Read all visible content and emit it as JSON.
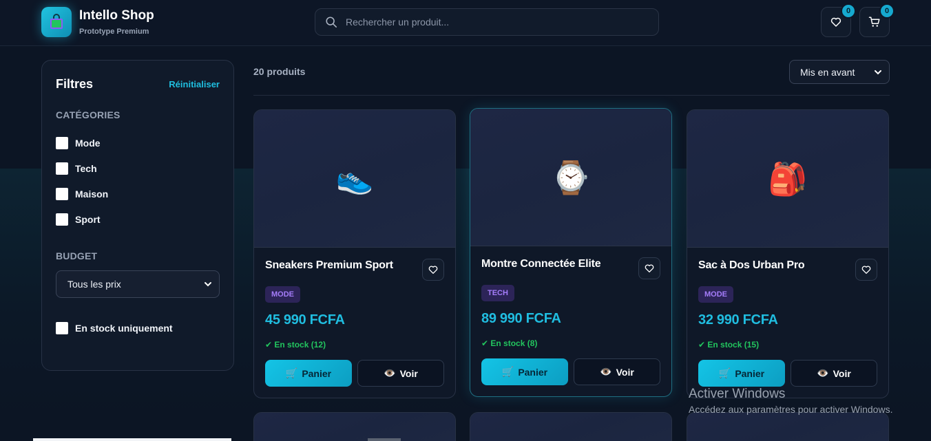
{
  "brand": {
    "title": "Intello Shop",
    "subtitle": "Prototype Premium",
    "logo_icon": "shopping-bag-icon"
  },
  "search": {
    "placeholder": "Rechercher un produit...",
    "value": ""
  },
  "header": {
    "wishlist": {
      "icon": "heart-icon",
      "count": "0"
    },
    "cart": {
      "icon": "cart-icon",
      "count": "0"
    }
  },
  "sidebar": {
    "title": "Filtres",
    "reset_label": "Réinitialiser",
    "categories_title": "CATÉGORIES",
    "categories": [
      {
        "label": "Mode",
        "checked": false
      },
      {
        "label": "Tech",
        "checked": false
      },
      {
        "label": "Maison",
        "checked": false
      },
      {
        "label": "Sport",
        "checked": false
      }
    ],
    "budget_title": "BUDGET",
    "budget_selected": "Tous les prix",
    "in_stock_label": "En stock uniquement",
    "in_stock_checked": false
  },
  "toolbar": {
    "count_label": "20 produits",
    "sort_selected": "Mis en avant"
  },
  "products": [
    {
      "name": "Sneakers Premium Sport",
      "category": "MODE",
      "price": "45 990 FCFA",
      "stock": "✔ En stock (12)",
      "emoji": "👟",
      "cart_label": "Panier",
      "view_label": "Voir"
    },
    {
      "name": "Montre Connectée Elite",
      "category": "TECH",
      "price": "89 990 FCFA",
      "stock": "✔ En stock (8)",
      "emoji": "⌚",
      "cart_label": "Panier",
      "view_label": "Voir"
    },
    {
      "name": "Sac à Dos Urban Pro",
      "category": "MODE",
      "price": "32 990 FCFA",
      "stock": "✔ En stock (15)",
      "emoji": "🎒",
      "cart_label": "Panier",
      "view_label": "Voir"
    }
  ],
  "watermark": {
    "title": "Activer Windows",
    "subtitle": "Accédez aux paramètres pour activer Windows."
  },
  "colors": {
    "accent": "#20bde0",
    "background": "#0c1524",
    "card": "#0f1828",
    "badge_bg": "#2c2458",
    "badge_text": "#a57dfa",
    "stock": "#22c55e"
  }
}
